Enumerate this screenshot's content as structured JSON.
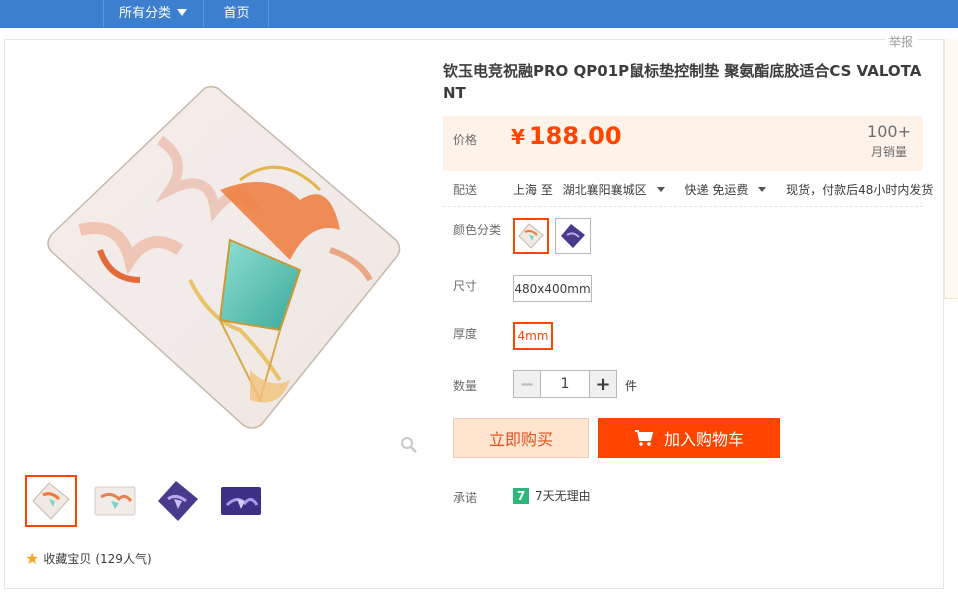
{
  "nav": {
    "categories_label": "所有分类",
    "home_label": "首页"
  },
  "report_label": "举报",
  "product": {
    "title": "钦玉电竞祝融PRO QP01P鼠标垫控制垫 聚氨酯底胶适合CS VALOTANT",
    "price_label": "价格",
    "currency": "¥",
    "price": "188.00",
    "sales_count": "100+",
    "sales_label": "月销量"
  },
  "delivery": {
    "label": "配送",
    "from": "上海 至",
    "to": "湖北襄阳襄城区",
    "method": "快递 免运费",
    "shipping_note": "现货，付款后48小时内发货"
  },
  "options": {
    "color_label": "颜色分类",
    "size_label": "尺寸",
    "size_value": "480x400mm",
    "thickness_label": "厚度",
    "thickness_value": "4mm",
    "quantity_label": "数量",
    "quantity_value": "1",
    "unit": "件"
  },
  "buttons": {
    "buy_now": "立即购买",
    "add_to_cart": "加入购物车"
  },
  "promise": {
    "label": "承诺",
    "badge": "7",
    "text": "7天无理由"
  },
  "favorite": {
    "label": "收藏宝贝",
    "popularity": "(129人气)"
  },
  "colors": {
    "accent": "#ff4400",
    "nav": "#3c7fcf",
    "price_bg": "#fff2e8"
  }
}
